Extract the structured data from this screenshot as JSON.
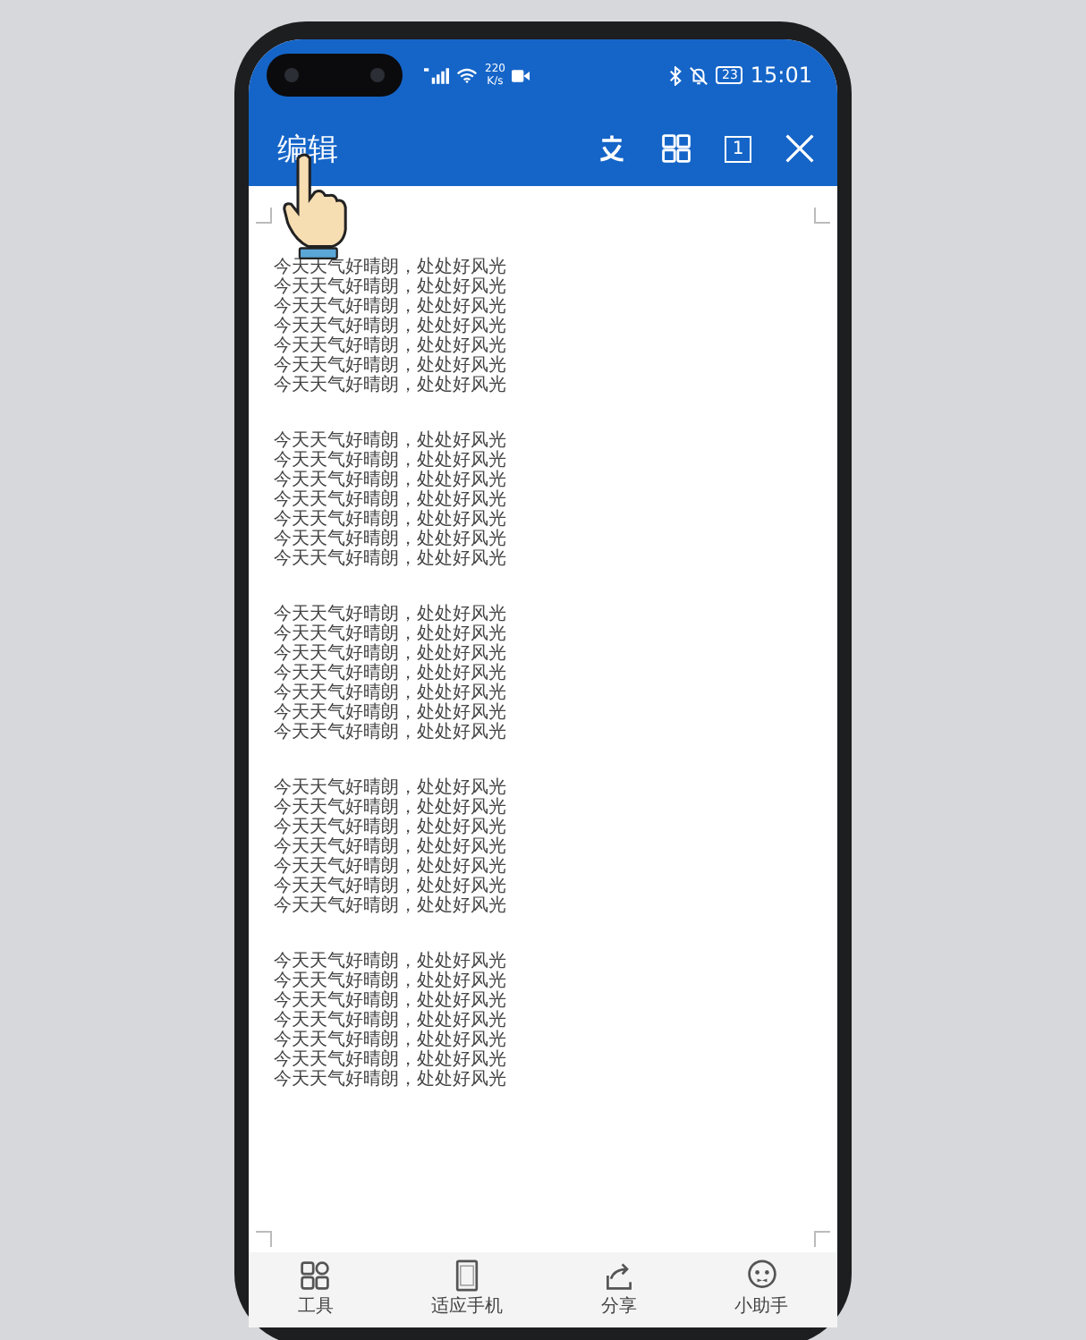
{
  "status_bar": {
    "network_speed": [
      "220",
      "K/s"
    ],
    "battery": "23",
    "time": "15:01"
  },
  "header": {
    "title": "编辑",
    "page_number": "1"
  },
  "document": {
    "paragraphs": [
      {
        "lines": [
          "今天天气好晴朗，处处好风光",
          "今天天气好晴朗，处处好风光",
          "今天天气好晴朗，处处好风光",
          "今天天气好晴朗，处处好风光",
          "今天天气好晴朗，处处好风光",
          "今天天气好晴朗，处处好风光",
          "今天天气好晴朗，处处好风光"
        ]
      },
      {
        "lines": [
          "今天天气好晴朗，处处好风光",
          "今天天气好晴朗，处处好风光",
          "今天天气好晴朗，处处好风光",
          "今天天气好晴朗，处处好风光",
          "今天天气好晴朗，处处好风光",
          "今天天气好晴朗，处处好风光",
          "今天天气好晴朗，处处好风光"
        ]
      },
      {
        "lines": [
          "今天天气好晴朗，处处好风光",
          "今天天气好晴朗，处处好风光",
          "今天天气好晴朗，处处好风光",
          "今天天气好晴朗，处处好风光",
          "今天天气好晴朗，处处好风光",
          "今天天气好晴朗，处处好风光",
          "今天天气好晴朗，处处好风光"
        ]
      },
      {
        "lines": [
          "今天天气好晴朗，处处好风光",
          "今天天气好晴朗，处处好风光",
          "今天天气好晴朗，处处好风光",
          "今天天气好晴朗，处处好风光",
          "今天天气好晴朗，处处好风光",
          "今天天气好晴朗，处处好风光",
          "今天天气好晴朗，处处好风光"
        ]
      },
      {
        "lines": [
          "今天天气好晴朗，处处好风光",
          "今天天气好晴朗，处处好风光",
          "今天天气好晴朗，处处好风光",
          "今天天气好晴朗，处处好风光",
          "今天天气好晴朗，处处好风光",
          "今天天气好晴朗，处处好风光",
          "今天天气好晴朗，处处好风光"
        ]
      }
    ]
  },
  "bottom_bar": {
    "items": [
      {
        "kind": "tools",
        "label": "工具"
      },
      {
        "kind": "fit",
        "label": "适应手机"
      },
      {
        "kind": "share",
        "label": "分享"
      },
      {
        "kind": "assistant",
        "label": "小助手"
      }
    ]
  }
}
